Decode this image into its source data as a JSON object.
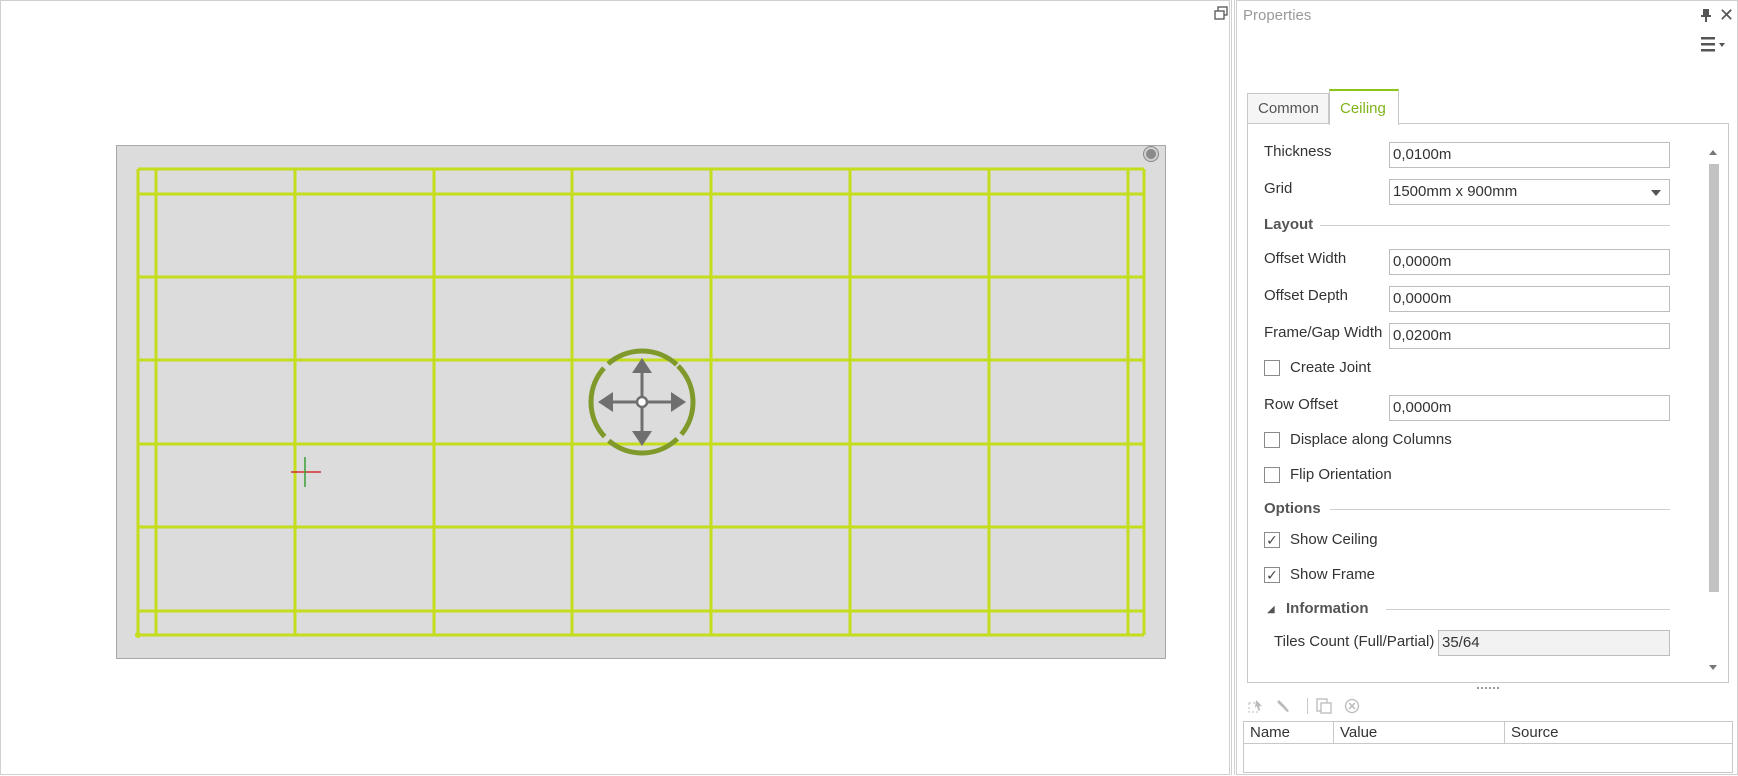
{
  "colors": {
    "accent": "#8cc41a",
    "grid_line": "#c4dd1c",
    "ceiling_fill": "#dcdcdc",
    "move_gizmo_ring": "#7f9a2a",
    "move_gizmo_arrows": "#6f6f6f"
  },
  "viewport": {
    "restore_icon": "restore-window-icon",
    "gizmo_icon": "move-gizmo-icon",
    "origin_icon": "origin-cross-icon"
  },
  "properties": {
    "title": "Properties",
    "pin_icon": "pin-icon",
    "close_icon": "close-icon",
    "menu_icon": "menu-icon",
    "tabs": [
      {
        "label": "Common",
        "active": false
      },
      {
        "label": "Ceiling",
        "active": true
      }
    ],
    "fields": {
      "thickness": {
        "label": "Thickness",
        "value": "0,0100m"
      },
      "grid": {
        "label": "Grid",
        "value": "1500mm x 900mm"
      },
      "offset_width": {
        "label": "Offset Width",
        "value": "0,0000m"
      },
      "offset_depth": {
        "label": "Offset Depth",
        "value": "0,0000m"
      },
      "frame_gap_width": {
        "label": "Frame/Gap Width",
        "value": "0,0200m"
      },
      "row_offset": {
        "label": "Row Offset",
        "value": "0,0000m"
      },
      "tiles_count": {
        "label": "Tiles Count (Full/Partial)",
        "value": "35/64"
      }
    },
    "sections": {
      "layout": "Layout",
      "options": "Options",
      "information": "Information"
    },
    "checkboxes": {
      "create_joint": {
        "label": "Create Joint",
        "checked": false
      },
      "displace_columns": {
        "label": "Displace along Columns",
        "checked": false
      },
      "flip_orientation": {
        "label": "Flip Orientation",
        "checked": false
      },
      "show_ceiling": {
        "label": "Show Ceiling",
        "checked": true
      },
      "show_frame": {
        "label": "Show Frame",
        "checked": true
      }
    }
  },
  "attributes": {
    "columns": [
      "Name",
      "Value",
      "Source"
    ],
    "toolbar_icons": [
      "select-icon",
      "brush-icon",
      "copy-icon",
      "delete-icon"
    ]
  }
}
